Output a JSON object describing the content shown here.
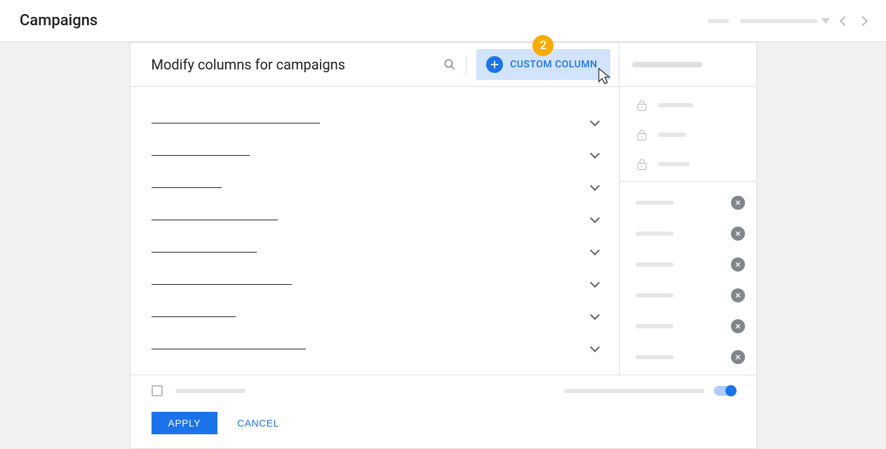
{
  "topbar": {
    "title": "Campaigns"
  },
  "modal": {
    "title": "Modify columns for campaigns",
    "custom_column_label": "CUSTOM COLUMN",
    "step_badge": "2",
    "category_widths": [
      240,
      140,
      100,
      180,
      150,
      200,
      120,
      220
    ],
    "locked_widths": [
      50,
      40,
      45
    ],
    "removable_widths": [
      85,
      70,
      60,
      90,
      75,
      80
    ],
    "toggle_line_width": 200
  },
  "footer": {
    "apply_label": "APPLY",
    "cancel_label": "CANCEL",
    "checkbox_label_width": 100
  },
  "colors": {
    "accent": "#1a73e8",
    "badge": "#f9ab00",
    "highlight": "#d2e3fc"
  }
}
